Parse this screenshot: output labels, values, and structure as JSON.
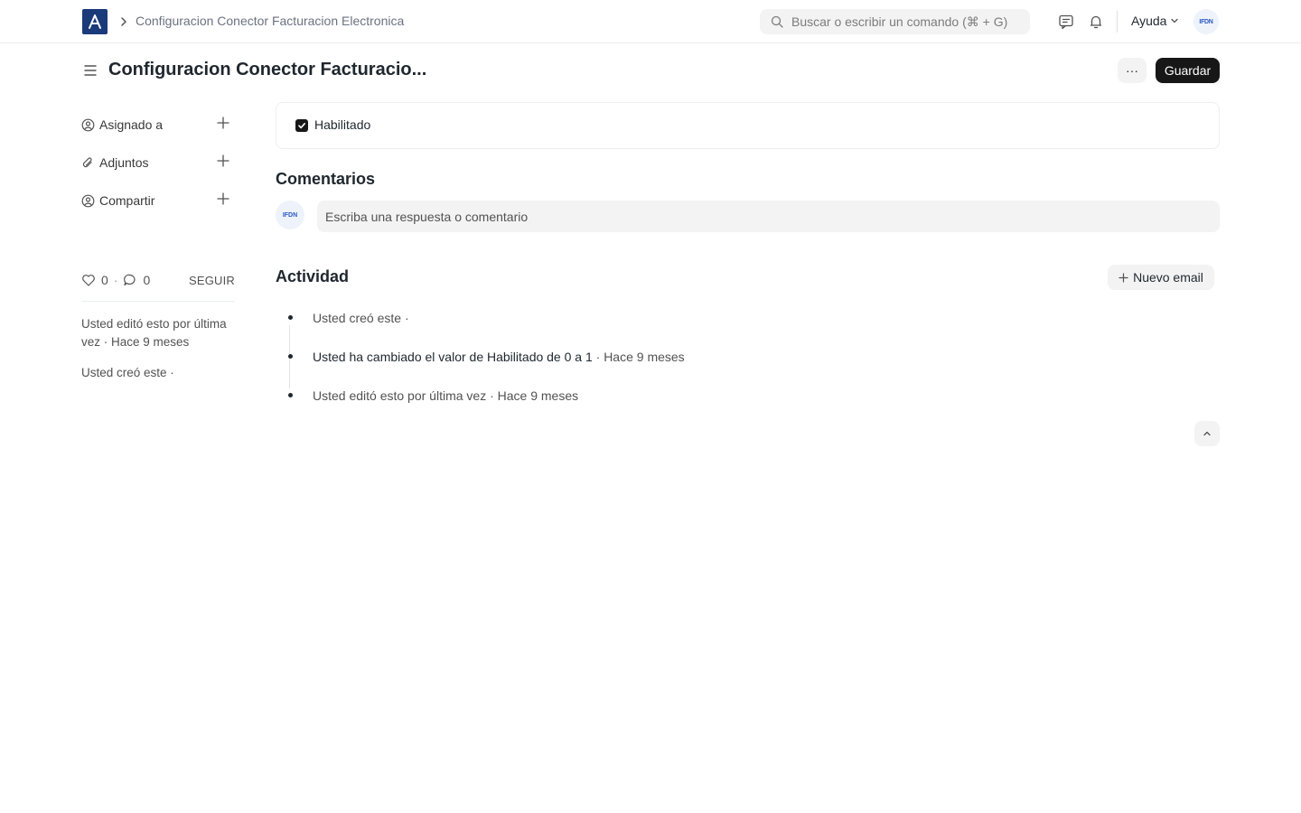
{
  "navbar": {
    "logo_icon": "app-logo",
    "breadcrumb": "Configuracion Conector Facturacion Electronica",
    "search_placeholder": "Buscar o escribir un comando (⌘ + G)",
    "help_label": "Ayuda",
    "avatar_initials": "IFDN"
  },
  "page": {
    "title": "Configuracion Conector Facturacio...",
    "more_label": "···",
    "save_label": "Guardar"
  },
  "sidebar": {
    "items": [
      {
        "label": "Asignado a",
        "icon": "assign-user-icon"
      },
      {
        "label": "Adjuntos",
        "icon": "paperclip-icon"
      },
      {
        "label": "Compartir",
        "icon": "share-user-icon"
      }
    ],
    "likes": "0",
    "comments": "0",
    "follow_label": "SEGUIR",
    "edited_note": "Usted editó esto por última vez · Hace 9 meses",
    "created_note": "Usted creó este ·"
  },
  "form": {
    "enabled_label": "Habilitado",
    "enabled_checked": true
  },
  "comments": {
    "title": "Comentarios",
    "placeholder": "Escriba una respuesta o comentario",
    "avatar_initials": "IFDN"
  },
  "activity": {
    "title": "Actividad",
    "new_email_label": "Nuevo email",
    "items": [
      {
        "text": "Usted creó este ·"
      },
      {
        "strong": "Usted ha cambiado el valor de Habilitado de 0 a 1",
        "muted": " · Hace 9 meses"
      },
      {
        "text": "Usted editó esto por última vez · Hace 9 meses"
      }
    ]
  },
  "colors": {
    "brand": "#1a3a7a",
    "primary_button": "#171717",
    "text": "#1f272e",
    "muted": "#525252",
    "surface": "#f3f3f3"
  }
}
